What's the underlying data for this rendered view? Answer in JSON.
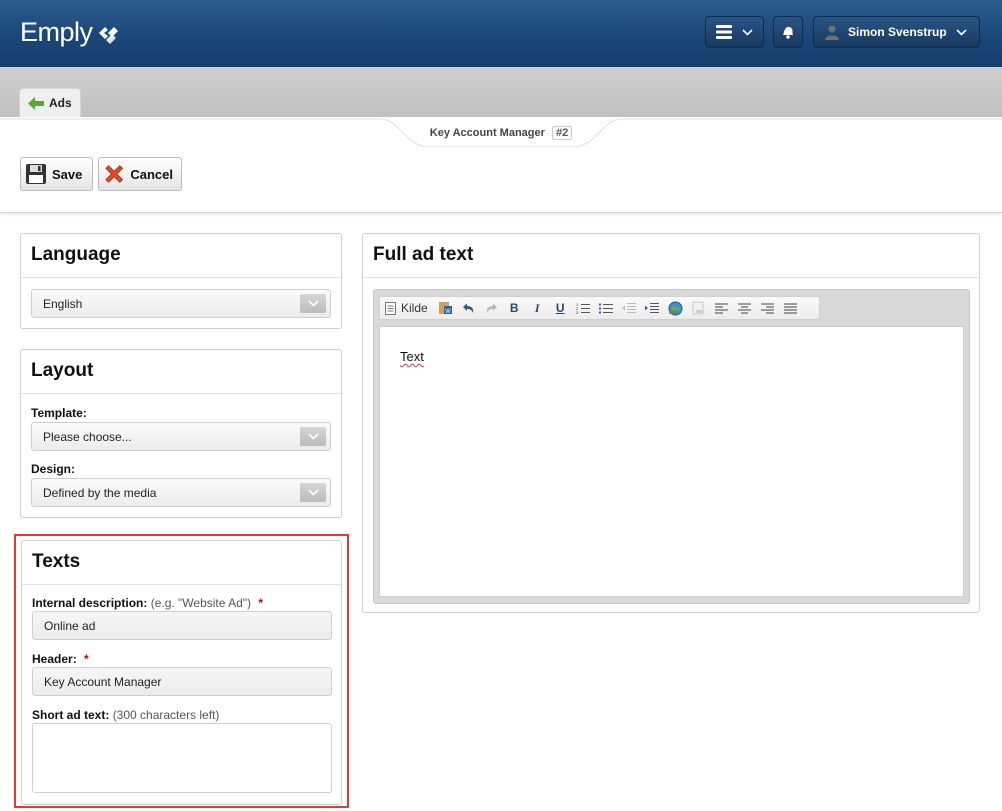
{
  "header": {
    "logo": "Emply",
    "user_name": "Simon Svenstrup"
  },
  "tabs": {
    "back_label": "Ads"
  },
  "title": {
    "text": "Key Account Manager",
    "id": "#2"
  },
  "toolbar": {
    "save_label": "Save",
    "cancel_label": "Cancel"
  },
  "language": {
    "heading": "Language",
    "selected": "English"
  },
  "layout": {
    "heading": "Layout",
    "template_label": "Template:",
    "template_value": "Please choose...",
    "design_label": "Design:",
    "design_value": "Defined by the media"
  },
  "texts": {
    "heading": "Texts",
    "internal_label": "Internal description:",
    "internal_hint": "(e.g. \"Website Ad\")",
    "internal_value": "Online ad",
    "header_label": "Header:",
    "header_value": "Key Account Manager",
    "short_label": "Short ad text:",
    "short_hint": "(300 characters left)",
    "short_value": "",
    "required_mark": "*"
  },
  "fullad": {
    "heading": "Full ad text",
    "source_label": "Kilde",
    "content": "Text"
  },
  "colors": {
    "header_bg": "#1a4777",
    "highlight": "#e23b2e",
    "required": "#cc0000"
  }
}
